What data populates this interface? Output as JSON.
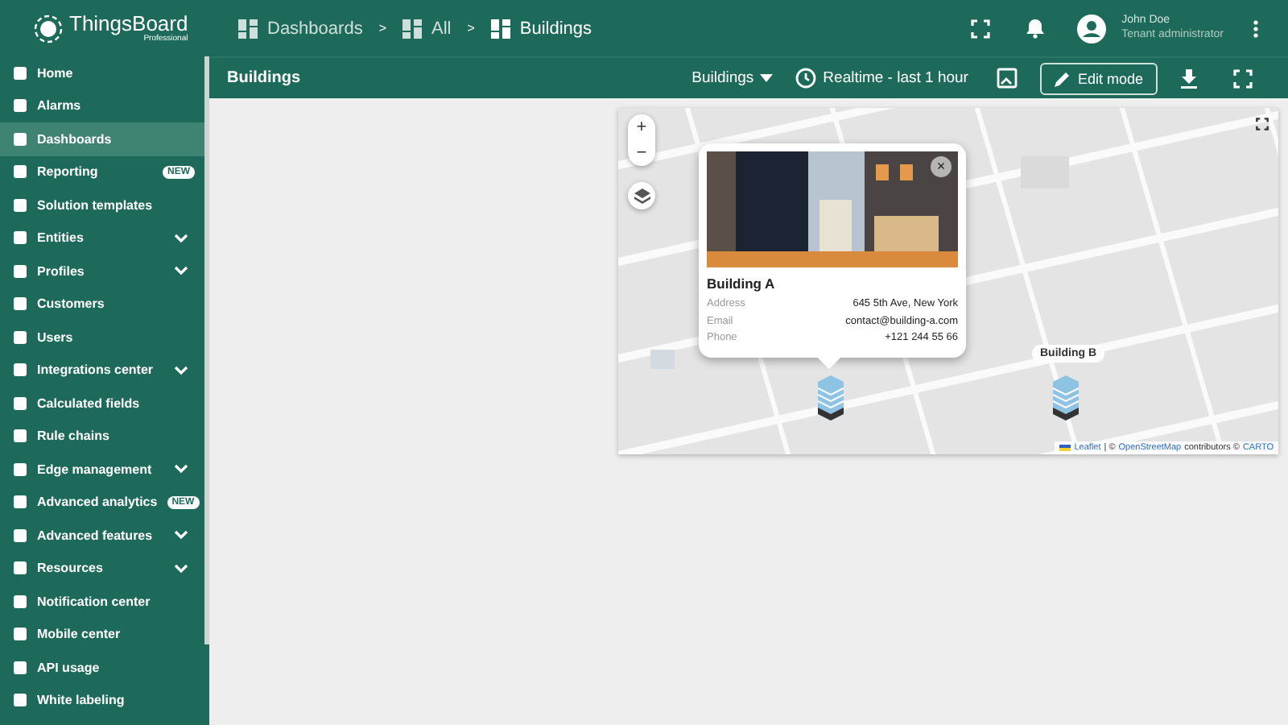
{
  "logo": {
    "name": "ThingsBoard",
    "edition": "Professional"
  },
  "breadcrumbs": [
    "Dashboards",
    "All",
    "Buildings"
  ],
  "breadcrumb_separator": ">",
  "user": {
    "name": "John Doe",
    "role": "Tenant administrator"
  },
  "sidebar": {
    "items": [
      {
        "label": "Home",
        "selected": false,
        "expandable": false
      },
      {
        "label": "Alarms",
        "selected": false,
        "expandable": false
      },
      {
        "label": "Dashboards",
        "selected": true,
        "expandable": false
      },
      {
        "label": "Reporting",
        "selected": false,
        "expandable": false,
        "badge": "NEW"
      },
      {
        "label": "Solution templates",
        "selected": false,
        "expandable": false
      },
      {
        "label": "Entities",
        "selected": false,
        "expandable": true
      },
      {
        "label": "Profiles",
        "selected": false,
        "expandable": true
      },
      {
        "label": "Customers",
        "selected": false,
        "expandable": false
      },
      {
        "label": "Users",
        "selected": false,
        "expandable": false
      },
      {
        "label": "Integrations center",
        "selected": false,
        "expandable": true
      },
      {
        "label": "Calculated fields",
        "selected": false,
        "expandable": false
      },
      {
        "label": "Rule chains",
        "selected": false,
        "expandable": false
      },
      {
        "label": "Edge management",
        "selected": false,
        "expandable": true
      },
      {
        "label": "Advanced analytics",
        "selected": false,
        "expandable": false,
        "badge": "NEW"
      },
      {
        "label": "Advanced features",
        "selected": false,
        "expandable": true
      },
      {
        "label": "Resources",
        "selected": false,
        "expandable": true
      },
      {
        "label": "Notification center",
        "selected": false,
        "expandable": false
      },
      {
        "label": "Mobile center",
        "selected": false,
        "expandable": false
      },
      {
        "label": "API usage",
        "selected": false,
        "expandable": false
      },
      {
        "label": "White labeling",
        "selected": false,
        "expandable": false
      }
    ]
  },
  "dashboard": {
    "title": "Buildings",
    "state_selector": "Buildings",
    "timewindow": "Realtime - last 1 hour",
    "edit_button": "Edit mode"
  },
  "map": {
    "popup": {
      "title": "Building A",
      "close": "×",
      "fields": [
        {
          "label": "Address",
          "value": "645 5th Ave, New York"
        },
        {
          "label": "Email",
          "value": "contact@building-a.com"
        },
        {
          "label": "Phone",
          "value": "+121 244 55 66"
        }
      ]
    },
    "zoom_in": "+",
    "zoom_out": "−",
    "markers": [
      {
        "label": "Building B"
      }
    ],
    "attribution": {
      "leaflet": "Leaflet",
      "sep": "| ©",
      "osm": "OpenStreetMap",
      "contrib": "contributors ©",
      "carto": "CARTO"
    }
  }
}
